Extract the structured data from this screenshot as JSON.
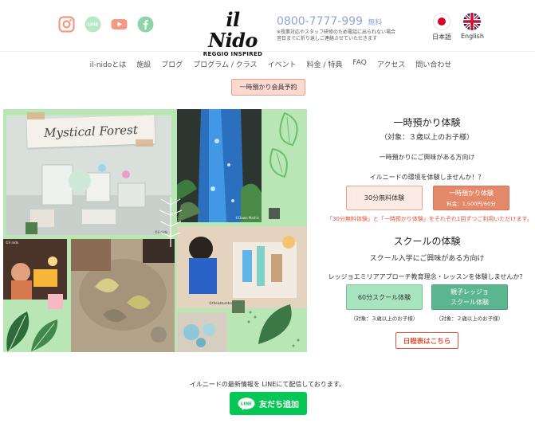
{
  "header": {
    "logo": {
      "name": "il Nido",
      "tagline": "REGGIO INSPIRED"
    },
    "phone": {
      "number": "0800-7777-999",
      "free_label": "無料",
      "note_line1": "※授業対応やスタッフ研修のため電話に出られない場合",
      "note_line2": "翌日までに折り返しご連絡させていただきます"
    },
    "social": [
      "instagram-icon",
      "line-icon",
      "youtube-icon",
      "facebook-icon"
    ],
    "languages": [
      {
        "label": "日本語"
      },
      {
        "label": "English"
      }
    ]
  },
  "nav": {
    "items": [
      "il-nidoとは",
      "施設",
      "ブログ",
      "プログラム / クラス",
      "イベント",
      "料金 / 特典",
      "FAQ",
      "アクセス",
      "問い合わせ"
    ]
  },
  "top_button": "一時預かり会員予約",
  "collage": {
    "banner_text": "Mystical Forest",
    "watermarks": [
      "©Dawn Mathis",
      "©il nido",
      "©il nido",
      "©thenatureteach.co"
    ]
  },
  "temporary": {
    "title": "一時預かり体験",
    "target": "（対象：３歳以上のお子様）",
    "interest": "一時預かりにご興味がある方向け",
    "question": "イルニードの環境を体験しませんか！？",
    "free_button": "30分無料体験",
    "paid_button_line1": "一時預かり体験",
    "paid_button_line2": "料金：1,500円/60分",
    "note": "「30分無料体験」と「一時預かり体験」をそれぞれ1回ずつご利用いただけます。"
  },
  "school": {
    "title": "スクールの体験",
    "interest": "スクール入学にご興味がある方向け",
    "question": "レッジョエミリアアプローチ教育理念・レッスンを体験しませんか？",
    "trial_button": "60分スクール体験",
    "parent_button_line1": "親子レッジョ",
    "parent_button_line2": "スクール体験",
    "trial_target": "（対象：３歳以上のお子様）",
    "parent_target": "（対象：２歳以上のお子様）",
    "schedule_button": "日程表はこちら"
  },
  "footer": {
    "info_text": "イルニードの最新情報を LINEにて配信しております。",
    "line_button": "友だち追加",
    "line_badge": "LINE"
  },
  "colors": {
    "phone": "#8fa6d8",
    "peach": "#fbd9cf",
    "orange": "#e4886a",
    "mint": "#a8e4bf",
    "teal": "#5bb58e",
    "red": "#e0533b",
    "line_green": "#06c755",
    "collage_bg": "#b9e6b5"
  }
}
